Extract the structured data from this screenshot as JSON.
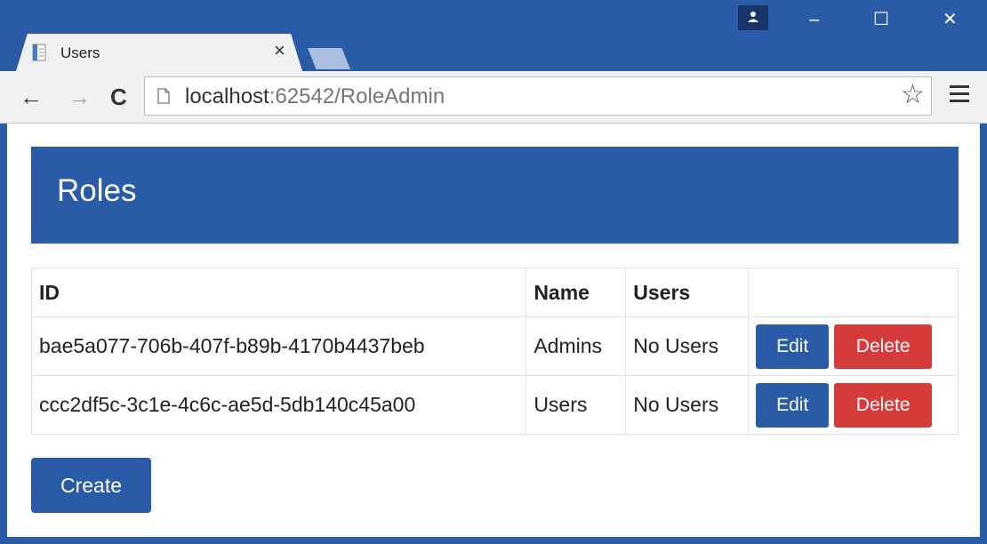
{
  "browser": {
    "tab_title": "Users",
    "url_host": "localhost",
    "url_path": ":62542/RoleAdmin",
    "icons": {
      "close": "close-icon",
      "back": "back-arrow-icon",
      "forward": "forward-arrow-icon",
      "reload": "reload-icon",
      "page": "page-icon",
      "bookmark": "star-icon",
      "menu": "hamburger-menu-icon",
      "profile": "profile-icon"
    },
    "window_controls": {
      "minimize": "–",
      "maximize": "☐",
      "close": "✕"
    },
    "nav_glyphs": {
      "back": "←",
      "forward": "→",
      "reload": "C",
      "star": "☆",
      "tab_close": "×"
    },
    "colors": {
      "chrome": "#2a5ba7",
      "toolbar": "#f1f1f1"
    }
  },
  "page": {
    "heading": "Roles",
    "table": {
      "headers": [
        "ID",
        "Name",
        "Users",
        ""
      ],
      "rows": [
        {
          "id": "bae5a077-706b-407f-b89b-4170b4437beb",
          "name": "Admins",
          "users": "No Users",
          "edit_label": "Edit",
          "delete_label": "Delete"
        },
        {
          "id": "ccc2df5c-3c1e-4c6c-ae5d-5db140c45a00",
          "name": "Users",
          "users": "No Users",
          "edit_label": "Edit",
          "delete_label": "Delete"
        }
      ]
    },
    "create_label": "Create",
    "colors": {
      "primary": "#2a5ba7",
      "danger": "#d63b3b"
    }
  }
}
